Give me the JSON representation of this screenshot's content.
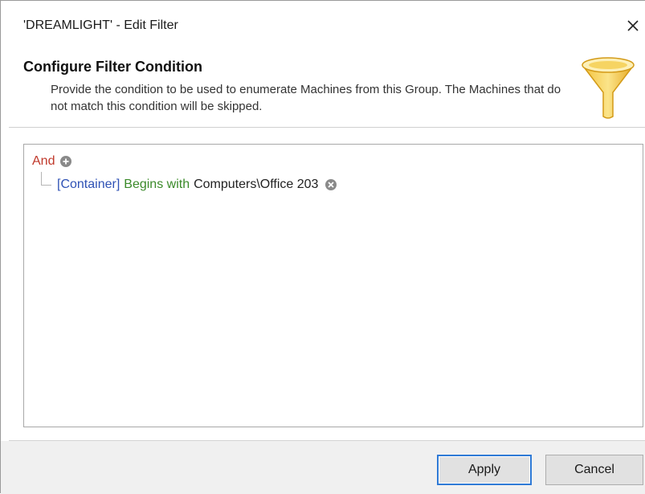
{
  "window": {
    "title": "'DREAMLIGHT' - Edit Filter",
    "close_icon": "close-icon"
  },
  "header": {
    "title": "Configure Filter Condition",
    "description": "Provide the condition to be used to enumerate Machines from this Group. The Machines that do not match this condition will be skipped.",
    "icon": "funnel-icon"
  },
  "filter": {
    "operator": "And",
    "add_icon": "add-condition-icon",
    "conditions": [
      {
        "field": "[Container]",
        "comparison": "Begins with",
        "value": "Computers\\Office 203",
        "remove_icon": "remove-condition-icon"
      }
    ]
  },
  "buttons": {
    "apply": "Apply",
    "cancel": "Cancel"
  },
  "colors": {
    "operator": "#c0392b",
    "field": "#2f52b5",
    "comparison": "#3b8a2a",
    "default_button_border": "#2f7ad6"
  }
}
